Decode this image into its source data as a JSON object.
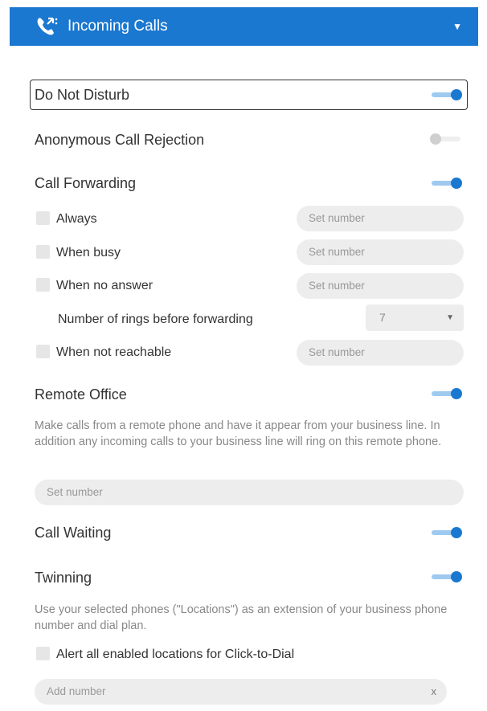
{
  "colors": {
    "accent": "#1b78d0"
  },
  "header": {
    "title": "Incoming Calls",
    "icon": "phone-icon",
    "collapse_icon": "caret-down-icon"
  },
  "dnd": {
    "label": "Do Not Disturb",
    "enabled": true
  },
  "anonymous": {
    "label": "Anonymous Call Rejection",
    "enabled": false
  },
  "forwarding": {
    "label": "Call Forwarding",
    "enabled": true,
    "always": {
      "label": "Always",
      "placeholder": "Set number"
    },
    "busy": {
      "label": "When busy",
      "placeholder": "Set number"
    },
    "no_answer": {
      "label": "When no answer",
      "placeholder": "Set number"
    },
    "rings": {
      "label": "Number of rings before forwarding",
      "value": "7"
    },
    "not_reachable": {
      "label": "When not reachable",
      "placeholder": "Set number"
    }
  },
  "remote_office": {
    "label": "Remote Office",
    "enabled": true,
    "description": "Make calls from a remote phone and have it appear from your business line. In addition any incoming calls to your business line will ring on this remote phone.",
    "placeholder": "Set number"
  },
  "call_waiting": {
    "label": "Call Waiting",
    "enabled": true
  },
  "twinning": {
    "label": "Twinning",
    "enabled": true,
    "description": "Use your selected phones (\"Locations\") as an extension of your business phone number and dial plan.",
    "alert_label": "Alert all enabled locations for Click-to-Dial",
    "placeholder": "Add number",
    "clear": "x"
  }
}
